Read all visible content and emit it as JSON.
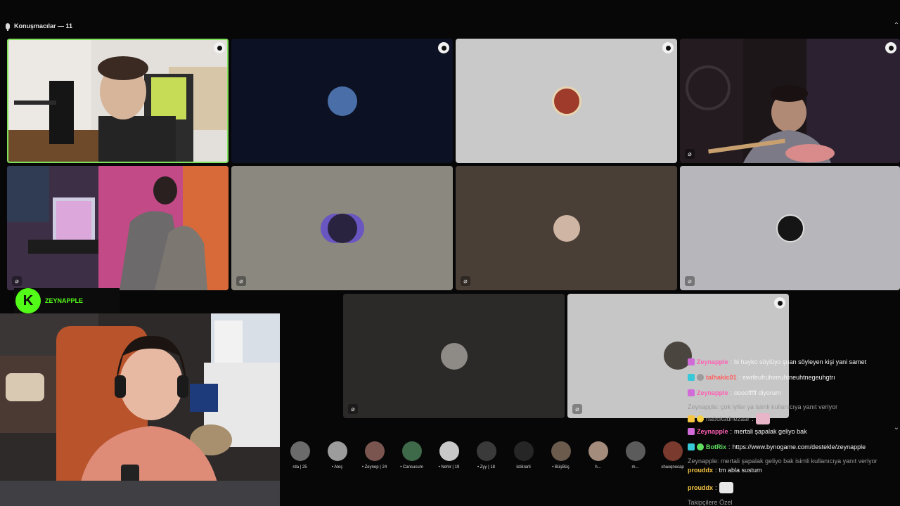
{
  "header": {
    "speakers_label": "Konuşmacılar — 11"
  },
  "brand": {
    "name": "ZEYNAPPLE",
    "logo_letter": "K",
    "accent": "#53fc18"
  },
  "tiles": [
    {
      "id": "speaker-1",
      "kind": "video",
      "bg": "#d9d5cf",
      "active": true
    },
    {
      "id": "speaker-2",
      "kind": "avatar",
      "bg": "#0c1124",
      "avatar_color": "#4a6fa8"
    },
    {
      "id": "speaker-3",
      "kind": "avatar",
      "bg": "#c9c9c9",
      "avatar_color": "#9e3b2b"
    },
    {
      "id": "speaker-4",
      "kind": "video",
      "bg": "#1a1517"
    },
    {
      "id": "speaker-5",
      "kind": "video",
      "bg": "#5a3d66"
    },
    {
      "id": "speaker-6",
      "kind": "avatar",
      "bg": "#8b887f",
      "avatar_color": "#5b46a8"
    },
    {
      "id": "speaker-7",
      "kind": "avatar",
      "bg": "#4a3f36",
      "avatar_color": "#cfb6a4"
    },
    {
      "id": "speaker-8",
      "kind": "avatar",
      "bg": "#b6b6bb",
      "avatar_color": "#151515"
    },
    {
      "id": "speaker-9",
      "kind": "avatar",
      "bg": "#2c2929",
      "avatar_color": "#8e8a86"
    },
    {
      "id": "speaker-10",
      "kind": "avatar",
      "bg": "#c6c6c6",
      "avatar_color": "#4b4540"
    }
  ],
  "audience": [
    {
      "name": "rda | 25",
      "color": "#6b6b6b"
    },
    {
      "name": "• Ateş",
      "color": "#9c9c9c"
    },
    {
      "name": "• Zeynep | 24",
      "color": "#7a5550"
    },
    {
      "name": "• Cansucum",
      "color": "#3f6a4a"
    },
    {
      "name": "• Nehir | 19",
      "color": "#c8c8c8"
    },
    {
      "name": "• Zyy | 18",
      "color": "#3a3a3a"
    },
    {
      "name": "istikrarli",
      "color": "#262626"
    },
    {
      "name": "• BüşBüş",
      "color": "#6a5b4d"
    },
    {
      "name": "h...",
      "color": "#a38c7b"
    },
    {
      "name": "m...",
      "color": "#5b5b5b"
    },
    {
      "name": "shaxqnocap",
      "color": "#7a3a2d"
    }
  ],
  "chat": [
    {
      "user": "Zeynapple",
      "sep": ":",
      "text": "bi hayko söylüyo şuan söyleyen kişi yani samet",
      "user_class": "u-pink",
      "badge": "#d06bd8",
      "badge2": null
    },
    {
      "user": "talhakic01",
      "sep": ":",
      "text": "ewrfeufruherruhtneuhtnegeuhgtrı",
      "user_class": "u-red",
      "badge": "#38c9d8",
      "badge2": "#9b9b9b"
    },
    {
      "user": "Zeynapple",
      "sep": ":",
      "text": "oooofffff diyorum",
      "user_class": "u-pink",
      "badge": "#d06bd8",
      "badge2": null
    },
    {
      "user": "",
      "sep": "",
      "text": "Zeynapple: çok iyiler ya isimli kullanıcıya yanıt veriyor",
      "user_class": "u-grey",
      "badge": null,
      "badge2": null,
      "dim": true
    },
    {
      "user": "nabukadhezaar",
      "sep": ":",
      "text": "",
      "user_class": "u-grey",
      "badge": "#f5c542",
      "badge2": "#f5d142",
      "emote": "#e8b4c8"
    },
    {
      "user": "Zeynapple",
      "sep": ":",
      "text": "mertali şapalak geliyo bak",
      "user_class": "u-pink",
      "badge": "#d06bd8",
      "badge2": null
    },
    {
      "user": "BotRix",
      "sep": ":",
      "text": "https://www.bynogame.com/destekle/zeynapple",
      "user_class": "u-green",
      "badge": "#38c9d8",
      "badge2": "#5fe05f"
    },
    {
      "user": "",
      "sep": "",
      "text": "Zeynapple: mertali şapalak geliyo bak isimli kullanıcıya yanıt veriyor",
      "user_class": "u-grey",
      "badge": null,
      "badge2": null,
      "dim": true
    },
    {
      "user": "prouddx",
      "sep": ":",
      "text": "tm abla sustum",
      "user_class": "u-yellow",
      "badge": null,
      "badge2": null
    },
    {
      "user": "prouddx",
      "sep": ":",
      "text": "",
      "user_class": "u-yellow",
      "badge": null,
      "badge2": null,
      "emote": "#e8e8e8"
    },
    {
      "user": "",
      "sep": "",
      "text": "Takipçilere Özel",
      "user_class": "u-grey",
      "badge": null,
      "badge2": null,
      "dim": true
    }
  ]
}
